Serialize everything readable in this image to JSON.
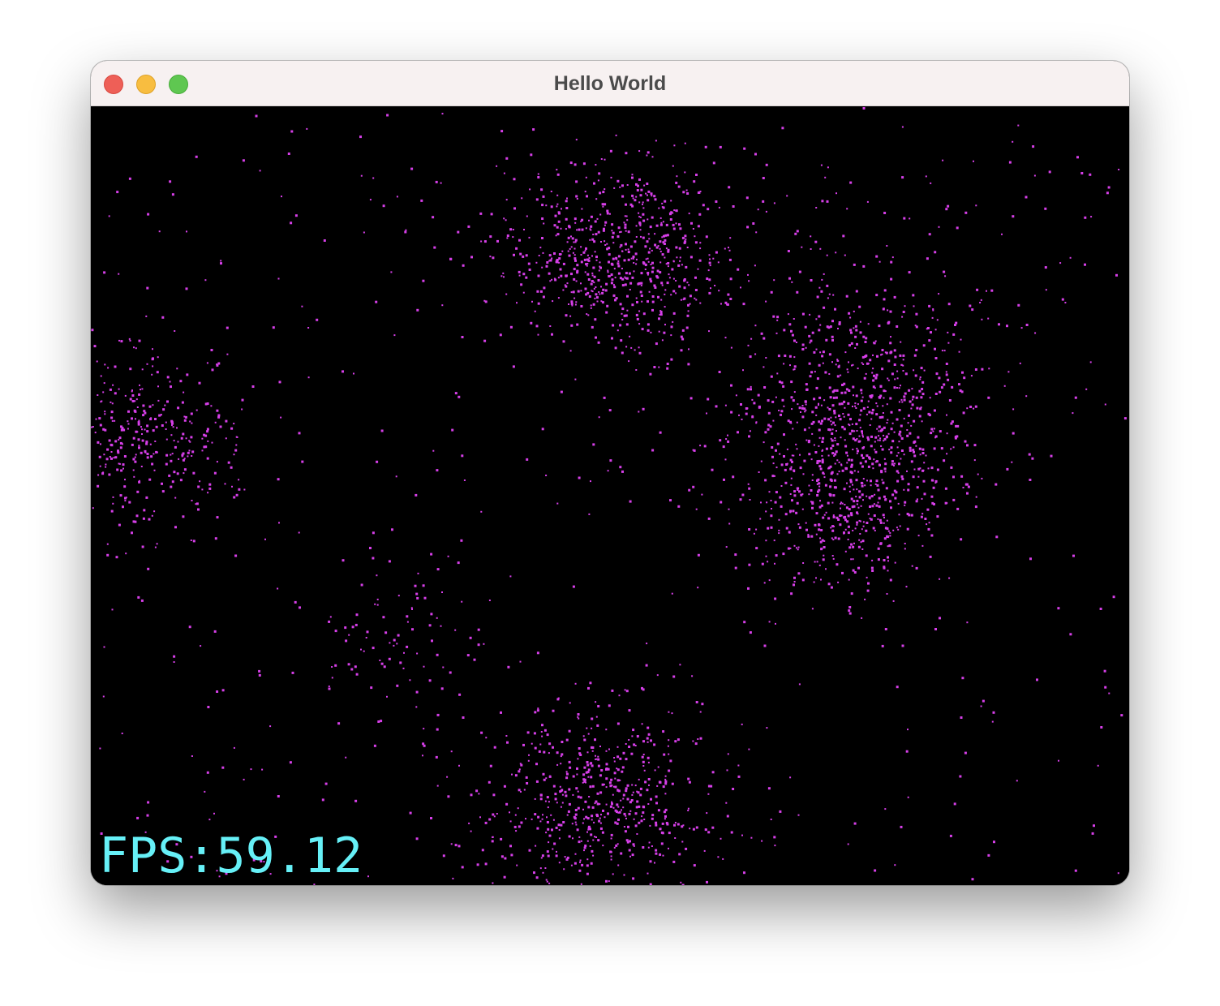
{
  "window": {
    "title": "Hello World"
  },
  "hud": {
    "fps_text": "FPS:59.12"
  },
  "colors": {
    "particle": "#d63fe8",
    "fps_text": "#66f0f7",
    "canvas_background": "#000000",
    "titlebar_background": "#f7f1f1",
    "close": "#ee5f57",
    "minimize": "#f8bd40",
    "zoom": "#5fc751"
  },
  "icons": {
    "close": "close-icon",
    "minimize": "minimize-icon",
    "zoom": "zoom-icon"
  }
}
